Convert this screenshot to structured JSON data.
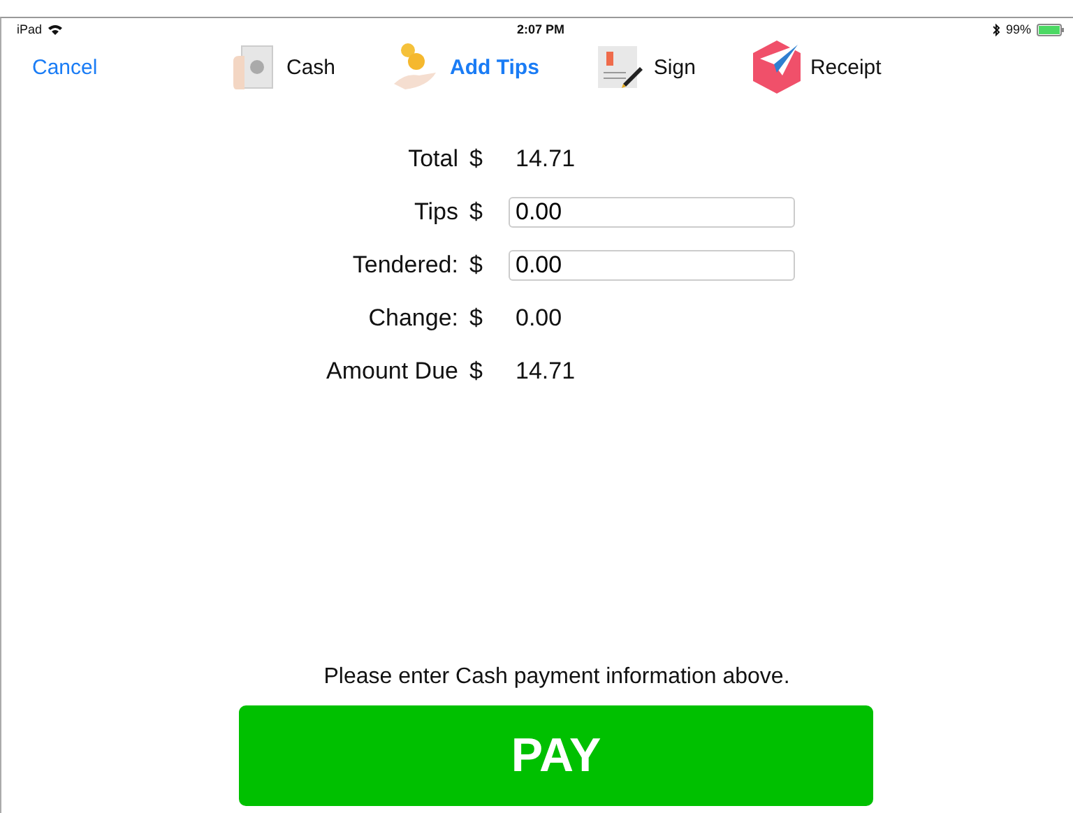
{
  "status_bar": {
    "device": "iPad",
    "time": "2:07 PM",
    "battery": "99%"
  },
  "nav": {
    "cancel": "Cancel",
    "tabs": [
      {
        "label": "Cash",
        "kind": "cash",
        "selected": false
      },
      {
        "label": "Add Tips",
        "kind": "tips",
        "selected": true
      },
      {
        "label": "Sign",
        "kind": "sign",
        "selected": false
      },
      {
        "label": "Receipt",
        "kind": "receipt",
        "selected": false
      }
    ]
  },
  "form": [
    {
      "label": "Total",
      "currency": "$",
      "value": "14.71",
      "kind": "text"
    },
    {
      "label": "Tips",
      "currency": "$",
      "value": "0.00",
      "kind": "input"
    },
    {
      "label": "Tendered:",
      "currency": "$",
      "value": "0.00",
      "kind": "input"
    },
    {
      "label": "Change:",
      "currency": "$",
      "value": "0.00",
      "kind": "text"
    },
    {
      "label": "Amount Due",
      "currency": "$",
      "value": "14.71",
      "kind": "text"
    }
  ],
  "message": "Please enter Cash payment information above.",
  "pay_button": "PAY"
}
